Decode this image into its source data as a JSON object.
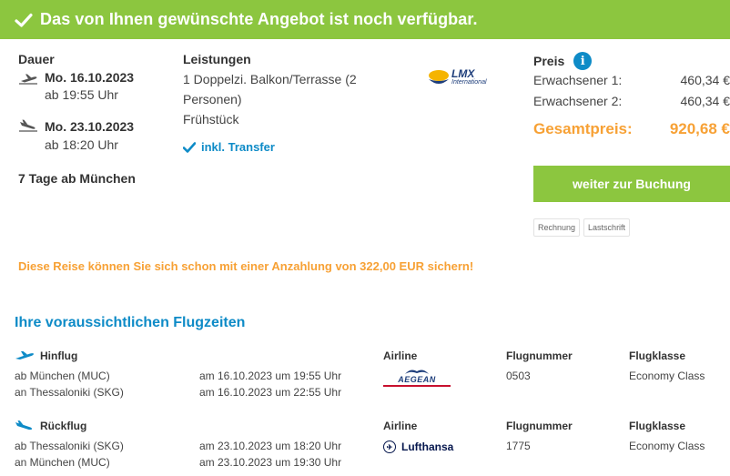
{
  "banner": {
    "text": "Das von Ihnen gewünschte Angebot ist noch verfügbar.",
    "check_icon": "checkmark-icon"
  },
  "duration": {
    "heading": "Dauer",
    "outbound": {
      "date": "Mo. 16.10.2023",
      "time": "ab 19:55 Uhr",
      "icon": "plane-departure-icon"
    },
    "return": {
      "date": "Mo. 23.10.2023",
      "time": "ab 18:20 Uhr",
      "icon": "plane-arrival-icon"
    },
    "summary": "7 Tage ab München"
  },
  "services": {
    "heading": "Leistungen",
    "room_line1": "1 Doppelzi. Balkon/Terrasse (2",
    "room_line2": "Personen)",
    "board": "Frühstück",
    "transfer": "inkl. Transfer"
  },
  "operator_logo": {
    "name": "LMX",
    "subtitle": "International"
  },
  "price": {
    "heading": "Preis",
    "adult1_label": "Erwachsener 1:",
    "adult1_value": "460,34 €",
    "adult2_label": "Erwachsener 2:",
    "adult2_value": "460,34 €",
    "total_label": "Gesamtpreis:",
    "total_value": "920,68 €",
    "book_label": "weiter zur Buchung",
    "payment_methods": [
      "Rechnung",
      "Lastschrift"
    ]
  },
  "deposit_text": "Diese Reise können Sie sich schon mit einer Anzahlung von 322,00 EUR sichern!",
  "flights": {
    "title": "Ihre voraussichtlichen Flugzeiten",
    "col_airline": "Airline",
    "col_flightno": "Flugnummer",
    "col_class": "Flugklasse",
    "outbound": {
      "label": "Hinflug",
      "from": "ab München (MUC)",
      "to": "an Thessaloniki (SKG)",
      "dep": "am 16.10.2023 um 19:55 Uhr",
      "arr": "am 16.10.2023 um 22:55 Uhr",
      "airline": "AEGEAN",
      "flight_no": "0503",
      "class": "Economy Class"
    },
    "return": {
      "label": "Rückflug",
      "from": "ab Thessaloniki (SKG)",
      "to": "an München (MUC)",
      "dep": "am 23.10.2023 um 18:20 Uhr",
      "arr": "am 23.10.2023 um 19:30 Uhr",
      "airline": "Lufthansa",
      "flight_no": "1775",
      "class": "Economy Class"
    }
  },
  "colors": {
    "green": "#8cc63f",
    "blue": "#0e8bc7",
    "orange": "#f7a135"
  }
}
